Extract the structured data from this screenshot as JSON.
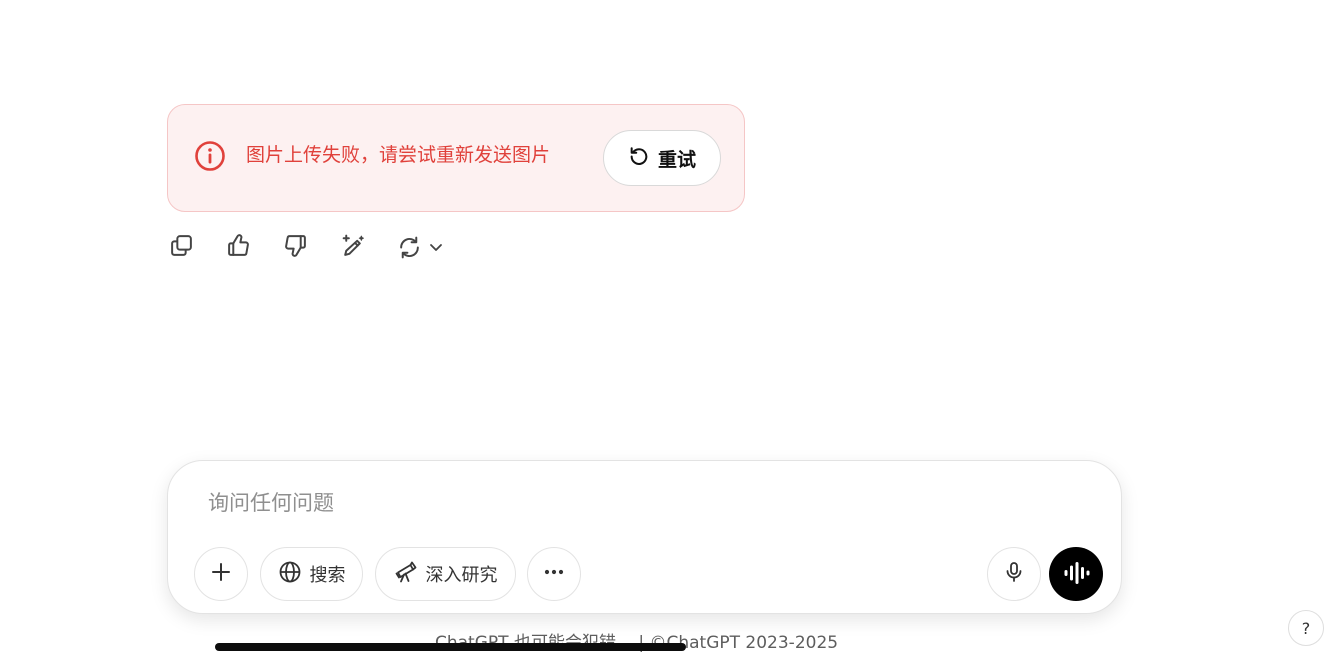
{
  "error_banner": {
    "message": "图片上传失败，请尝试重新发送图片",
    "retry_label": "重试",
    "icon": "alert-circle-icon",
    "accent_color": "#e0413b"
  },
  "message_actions": {
    "icons": [
      "copy-icon",
      "thumbs-up-icon",
      "thumbs-down-icon",
      "edit-icon",
      "regenerate-icon",
      "chevron-down-icon"
    ]
  },
  "composer": {
    "placeholder": "询问任何问题",
    "value": "",
    "search_label": "搜索",
    "research_label": "深入研究",
    "icons": [
      "plus-icon",
      "globe-icon",
      "telescope-icon",
      "more-icon",
      "mic-icon",
      "voice-wave-icon"
    ]
  },
  "footer": {
    "note": "ChatGPT 也可能会犯错。 | ©ChatGPT 2023-2025"
  },
  "help": {
    "label": "?"
  }
}
